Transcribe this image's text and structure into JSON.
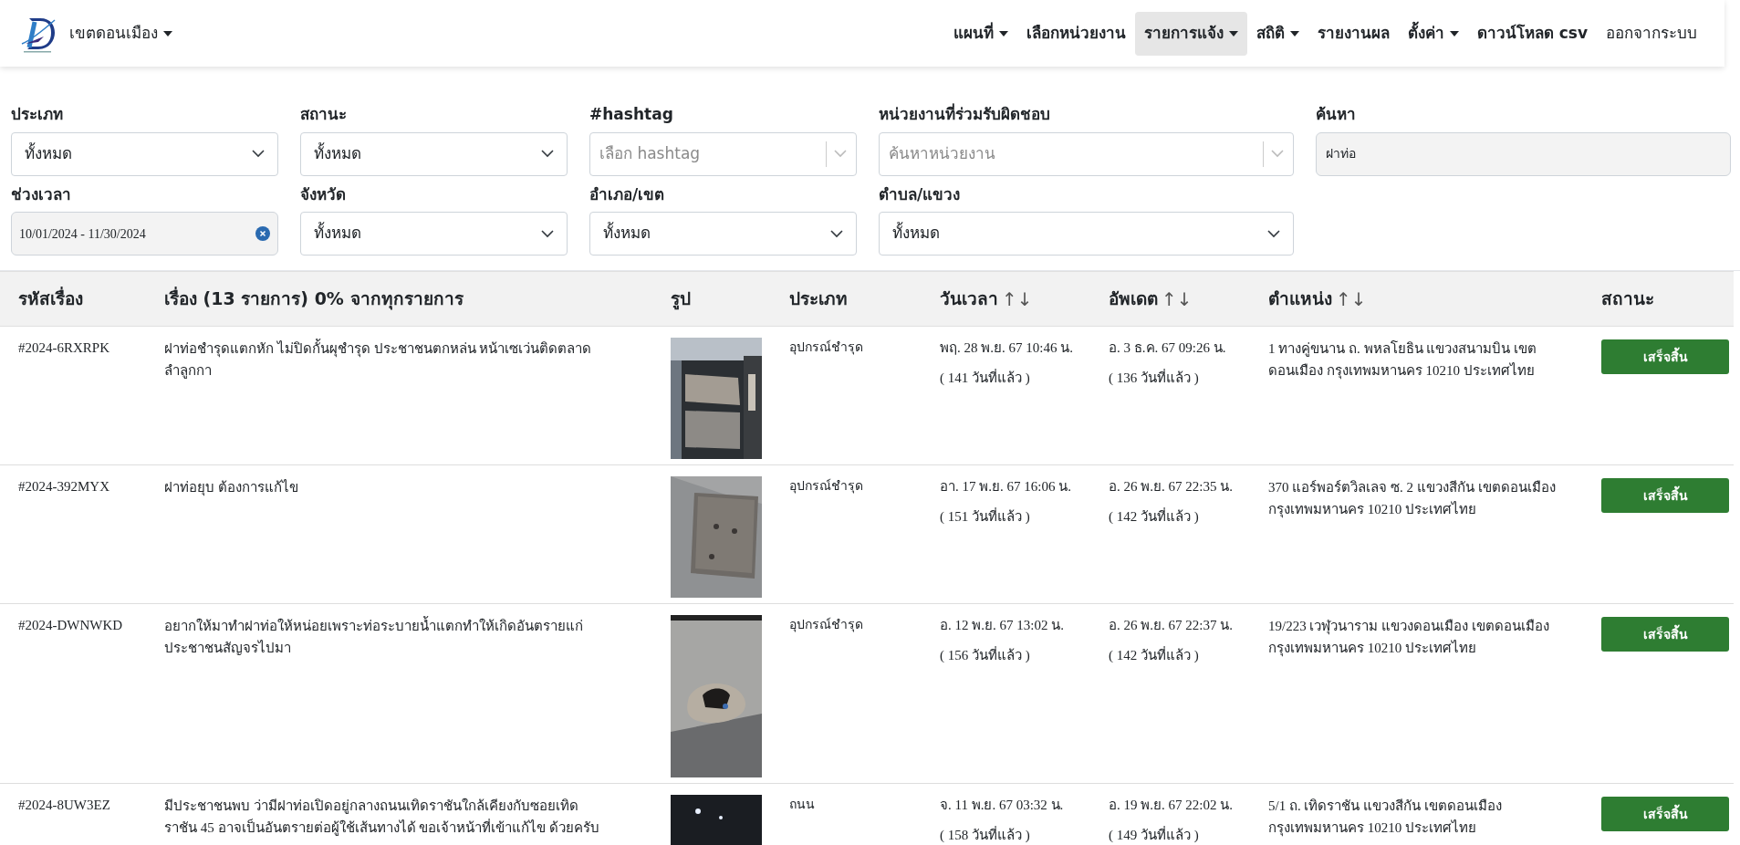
{
  "navbar": {
    "brand": "เขตดอนเมือง",
    "brand_dropdown": true,
    "items": [
      {
        "label": "แผนที่",
        "dropdown": true,
        "selected": false
      },
      {
        "label": "เลือกหน่วยงาน",
        "dropdown": false,
        "selected": false
      },
      {
        "label": "รายการแจ้ง",
        "dropdown": true,
        "selected": true
      },
      {
        "label": "สถิติ",
        "dropdown": true,
        "selected": false
      },
      {
        "label": "รายงานผล",
        "dropdown": false,
        "selected": false
      },
      {
        "label": "ตั้งค่า",
        "dropdown": true,
        "selected": false
      },
      {
        "label": "ดาวน์โหลด csv",
        "dropdown": false,
        "selected": false
      },
      {
        "label": "ออกจากระบบ",
        "dropdown": false,
        "selected": false,
        "kind": "plain"
      }
    ]
  },
  "filters": [
    {
      "label": "ประเภท",
      "kind": "select",
      "value": "ทั้งหมด"
    },
    {
      "label": "สถานะ",
      "kind": "select",
      "value": "ทั้งหมด"
    },
    {
      "label": "#hashtag",
      "kind": "combo",
      "placeholder": "เลือก hashtag"
    },
    {
      "label": "หน่วยงานที่ร่วมรับผิดชอบ",
      "kind": "combo",
      "placeholder": "ค้นหาหน่วยงาน"
    },
    {
      "label": "ค้นหา",
      "kind": "text",
      "value": "ฝาท่อ"
    },
    {
      "label": "ช่วงเวลา",
      "kind": "date",
      "value": "10/01/2024 - 11/30/2024"
    },
    {
      "label": "จังหวัด",
      "kind": "select",
      "value": "ทั้งหมด"
    },
    {
      "label": "อำเภอ/เขต",
      "kind": "select",
      "value": "ทั้งหมด"
    },
    {
      "label": "ตำบล/แขวง",
      "kind": "select",
      "value": "ทั้งหมด"
    }
  ],
  "table": {
    "columns": [
      {
        "label": "รหัสเรื่อง"
      },
      {
        "label": "เรื่อง (13 รายการ) 0% จากทุกรายการ"
      },
      {
        "label": "รูป"
      },
      {
        "label": "ประเภท"
      },
      {
        "label": "วันเวลา",
        "sort": "↑↓"
      },
      {
        "label": "อัพเดต",
        "sort": "↑↓"
      },
      {
        "label": "ตำแหน่ง",
        "sort": "↑↓"
      },
      {
        "label": "สถานะ"
      }
    ],
    "rows": [
      {
        "id": "#2024-6RXRPK",
        "title": "ฝาท่อชำรุดแตกหัก ไม่ปิดกั้นผุชำรุด ประชาชนตกหล่น หน้าเซเว่นติดตลาดลำลูกกา",
        "type": "อุปกรณ์ชำรุด",
        "created": "พฤ. 28 พ.ย. 67 10:46 น.",
        "created_ago": "( 141 วันที่แล้ว )",
        "updated": "อ. 3 ธ.ค. 67 09:26 น.",
        "updated_ago": "( 136 วันที่แล้ว )",
        "location": "1 ทางคู่ขนาน ถ. พหลโยธิน แขวงสนามบิน เขตดอนเมือง กรุงเทพมหานคร 10210 ประเทศไทย",
        "status": "เสร็จสิ้น"
      },
      {
        "id": "#2024-392MYX",
        "title": "ฝาท่อยุบ ต้องการแก้ไข",
        "type": "อุปกรณ์ชำรุด",
        "created": "อา. 17 พ.ย. 67 16:06 น.",
        "created_ago": "( 151 วันที่แล้ว )",
        "updated": "อ. 26 พ.ย. 67 22:35 น.",
        "updated_ago": "( 142 วันที่แล้ว )",
        "location": "370 แอร์พอร์ตวิลเลจ ซ. 2 แขวงสีกัน เขตดอนเมือง กรุงเทพมหานคร 10210 ประเทศไทย",
        "status": "เสร็จสิ้น"
      },
      {
        "id": "#2024-DWNWKD",
        "title": "อยากให้มาทำฝาท่อให้หน่อยเพราะท่อระบายน้ำแตกทำให้เกิดอันตรายแก่ประชาชนสัญจรไปมา",
        "type": "อุปกรณ์ชำรุด",
        "created": "อ. 12 พ.ย. 67 13:02 น.",
        "created_ago": "( 156 วันที่แล้ว )",
        "updated": "อ. 26 พ.ย. 67 22:37 น.",
        "updated_ago": "( 142 วันที่แล้ว )",
        "location": "19/223 เวฬุวนาราม แขวงดอนเมือง เขตดอนเมือง กรุงเทพมหานคร 10210 ประเทศไทย",
        "status": "เสร็จสิ้น"
      },
      {
        "id": "#2024-8UW3EZ",
        "title": "มีประชาชนพบ ว่ามีฝาท่อเปิดอยู่กลางถนนเทิดราชันใกล้เคียงกับซอยเทิดราชัน 45 อาจเป็นอันตรายต่อผู้ใช้เส้นทางได้ ขอเจ้าหน้าที่เข้าแก้ไข ด้วยครับ",
        "type": "ถนน",
        "created": "จ. 11 พ.ย. 67 03:32 น.",
        "created_ago": "( 158 วันที่แล้ว )",
        "updated": "อ. 19 พ.ย. 67 22:02 น.",
        "updated_ago": "( 149 วันที่แล้ว )",
        "location": "5/1 ถ. เทิดราชัน แขวงสีกัน เขตดอนเมือง กรุงเทพมหานคร 10210 ประเทศไทย",
        "status": "เสร็จสิ้น"
      }
    ]
  }
}
